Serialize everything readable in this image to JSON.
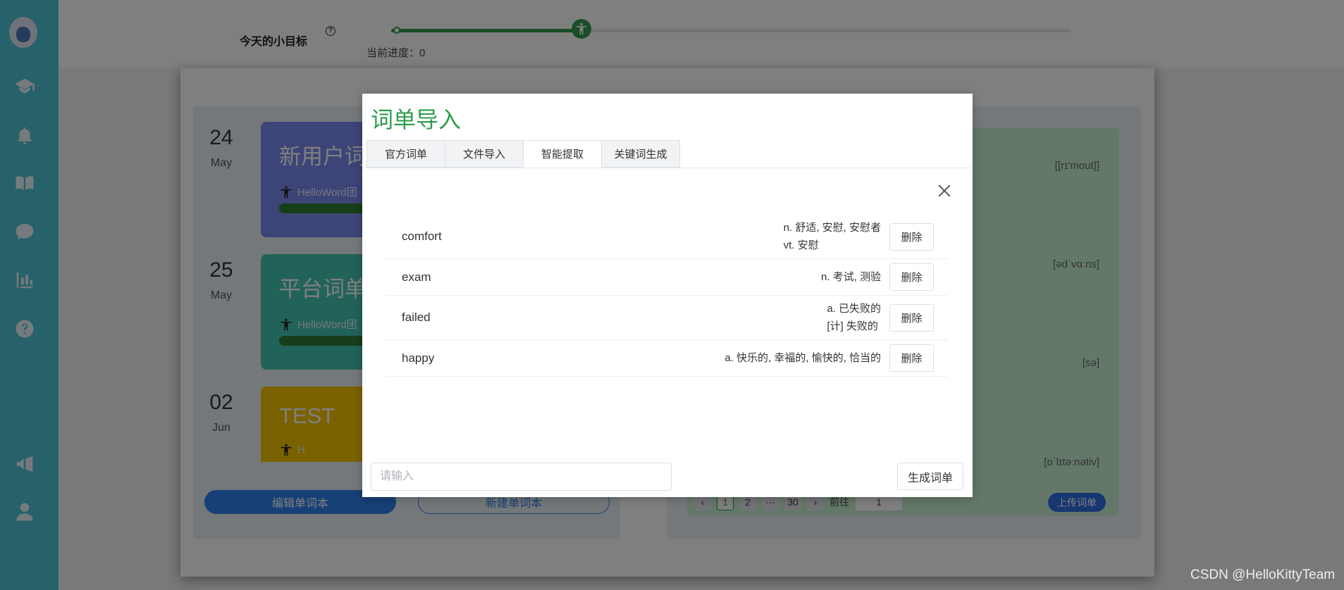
{
  "topbar": {
    "goal_label": "今天的小目标",
    "help": "?",
    "progress_text": "当前进度：0",
    "slider_value_percent": 28
  },
  "books": [
    {
      "day": "24",
      "month": "May",
      "title": "新用户词",
      "meta": "HelloWord团",
      "color": "#7b88f0"
    },
    {
      "day": "25",
      "month": "May",
      "title": "平台词单",
      "meta": "HelloWord团",
      "color": "#45c6b2"
    },
    {
      "day": "02",
      "month": "Jun",
      "title": "TEST",
      "meta": "H",
      "color": "#f5c400"
    }
  ],
  "left_actions": {
    "edit": "编辑单词本",
    "new": "新建单词本"
  },
  "right_panel": {
    "phonetics": [
      "[[rɪ'mout]]",
      "[ədˈvɑːns]",
      "[sə]",
      "[ɒˈlɪtəːnətiv]"
    ],
    "pager": {
      "prev": "‹",
      "pages": [
        "1",
        "2",
        "···",
        "30"
      ],
      "next": "›",
      "goto": "前往",
      "jump_value": "1"
    },
    "upload": "上传词单"
  },
  "dialog": {
    "title": "词单导入",
    "tabs": [
      "官方词单",
      "文件导入",
      "智能提取",
      "关键词生成"
    ],
    "active_tab": "智能提取",
    "words": [
      {
        "word": "comfort",
        "meaning1": "n. 舒适, 安慰, 安慰者",
        "meaning2": "vt. 安慰",
        "delete": "删除"
      },
      {
        "word": "exam",
        "meaning1": "n. 考试, 测验",
        "meaning2": "",
        "delete": "删除"
      },
      {
        "word": "failed",
        "meaning1": "a. 已失败的",
        "meaning2": "[计] 失败的",
        "delete": "删除"
      },
      {
        "word": "happy",
        "meaning1": "a. 快乐的, 幸福的, 愉快的, 恰当的",
        "meaning2": "",
        "delete": "删除"
      }
    ],
    "input_placeholder": "请输入",
    "generate": "生成词单"
  },
  "watermark": "CSDN @HelloKittyTeam"
}
